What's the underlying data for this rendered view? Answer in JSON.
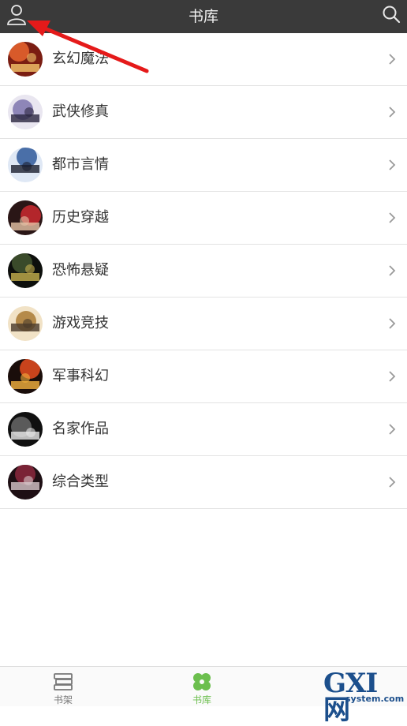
{
  "header": {
    "title": "书库"
  },
  "categories": [
    {
      "label": "玄幻魔法",
      "palette": [
        "#7a1d12",
        "#d85a2a",
        "#f5c66b"
      ]
    },
    {
      "label": "武侠修真",
      "palette": [
        "#e9e6f0",
        "#8e86b8",
        "#2b2740"
      ]
    },
    {
      "label": "都市言情",
      "palette": [
        "#dfe8f5",
        "#4a6fa8",
        "#1a1e2e"
      ]
    },
    {
      "label": "历史穿越",
      "palette": [
        "#2a1616",
        "#b3262b",
        "#e6c3a6"
      ]
    },
    {
      "label": "恐怖悬疑",
      "palette": [
        "#0d0f0c",
        "#3a4a2a",
        "#c6b04e"
      ]
    },
    {
      "label": "游戏竞技",
      "palette": [
        "#f1e2c6",
        "#b58a4a",
        "#4a3a2a"
      ]
    },
    {
      "label": "军事科幻",
      "palette": [
        "#1a0d0a",
        "#c8431c",
        "#f2b13e"
      ]
    },
    {
      "label": "名家作品",
      "palette": [
        "#101010",
        "#5a5a5a",
        "#e8e8e8"
      ]
    },
    {
      "label": "综合类型",
      "palette": [
        "#1e0f14",
        "#7a2336",
        "#d7c6c9"
      ]
    }
  ],
  "tabs": {
    "bookshelf": {
      "label": "书架"
    },
    "library": {
      "label": "书库"
    }
  },
  "watermark": {
    "big": "GXI网",
    "small": "system.com"
  },
  "colors": {
    "header_bg": "#3a3a3a",
    "active_tab": "#6cbf4e",
    "inactive_tab": "#777777",
    "annotation": "#e51a1a"
  }
}
